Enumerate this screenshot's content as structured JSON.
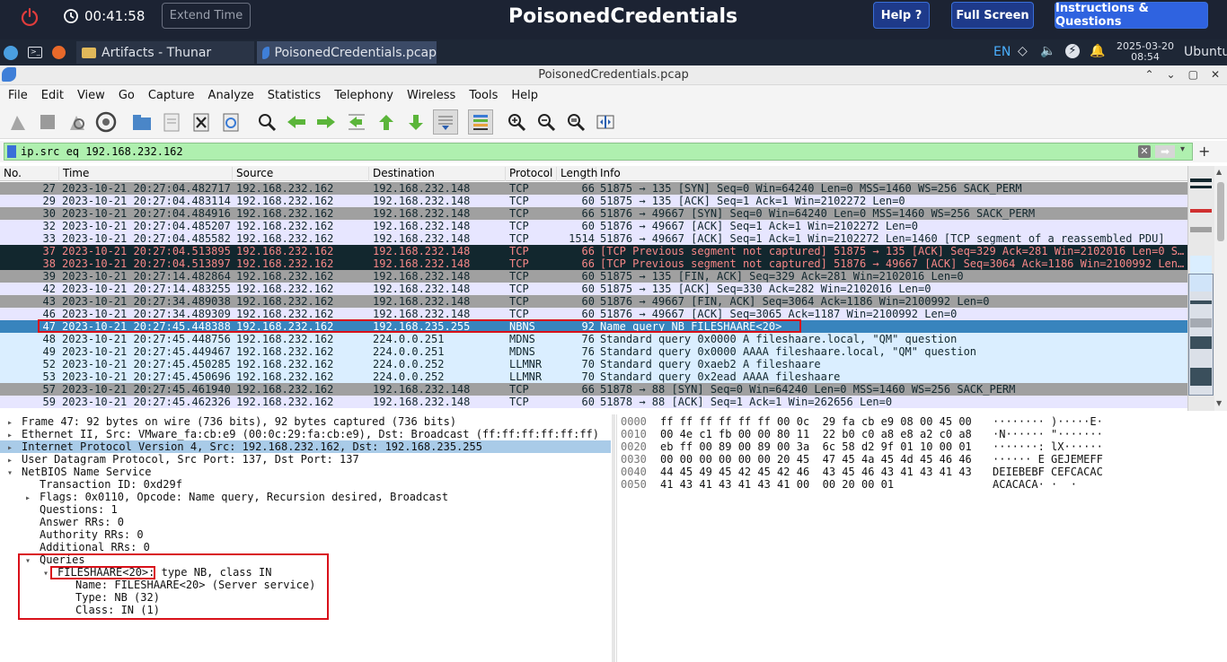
{
  "topbar": {
    "timer": "00:41:58",
    "extend_label": "Extend Time",
    "title": "PoisonedCredentials",
    "help_label": "Help ?",
    "fullscreen_label": "Full Screen",
    "instructions_label": "Instructions & Questions"
  },
  "taskbar": {
    "tasks": [
      "Artifacts - Thunar",
      "PoisonedCredentials.pcap"
    ],
    "lang": "EN",
    "date": "2025-03-20",
    "time": "08:54",
    "user": "Ubuntu"
  },
  "window": {
    "title": "PoisonedCredentials.pcap"
  },
  "menu": [
    "File",
    "Edit",
    "View",
    "Go",
    "Capture",
    "Analyze",
    "Statistics",
    "Telephony",
    "Wireless",
    "Tools",
    "Help"
  ],
  "filter": {
    "value": "ip.src eq 192.168.232.162"
  },
  "packet_list": {
    "columns": [
      "No.",
      "Time",
      "Source",
      "Destination",
      "Protocol",
      "Length",
      "Info"
    ],
    "rows": [
      {
        "no": "27",
        "time": "2023-10-21 20:27:04.482717",
        "src": "192.168.232.162",
        "dst": "192.168.232.148",
        "proto": "TCP",
        "len": "66",
        "info": "51875 → 135 [SYN] Seq=0 Win=64240 Len=0 MSS=1460 WS=256 SACK_PERM",
        "bg": "#a0a0a0",
        "fg": "#12272e"
      },
      {
        "no": "29",
        "time": "2023-10-21 20:27:04.483114",
        "src": "192.168.232.162",
        "dst": "192.168.232.148",
        "proto": "TCP",
        "len": "60",
        "info": "51875 → 135 [ACK] Seq=1 Ack=1 Win=2102272 Len=0",
        "bg": "#e7e6ff",
        "fg": "#12272e"
      },
      {
        "no": "30",
        "time": "2023-10-21 20:27:04.484916",
        "src": "192.168.232.162",
        "dst": "192.168.232.148",
        "proto": "TCP",
        "len": "66",
        "info": "51876 → 49667 [SYN] Seq=0 Win=64240 Len=0 MSS=1460 WS=256 SACK_PERM",
        "bg": "#a0a0a0",
        "fg": "#12272e"
      },
      {
        "no": "32",
        "time": "2023-10-21 20:27:04.485207",
        "src": "192.168.232.162",
        "dst": "192.168.232.148",
        "proto": "TCP",
        "len": "60",
        "info": "51876 → 49667 [ACK] Seq=1 Ack=1 Win=2102272 Len=0",
        "bg": "#e7e6ff",
        "fg": "#12272e"
      },
      {
        "no": "33",
        "time": "2023-10-21 20:27:04.485582",
        "src": "192.168.232.162",
        "dst": "192.168.232.148",
        "proto": "TCP",
        "len": "1514",
        "info": "51876 → 49667 [ACK] Seq=1 Ack=1 Win=2102272 Len=1460 [TCP segment of a reassembled PDU]",
        "bg": "#e7e6ff",
        "fg": "#12272e"
      },
      {
        "no": "37",
        "time": "2023-10-21 20:27:04.513895",
        "src": "192.168.232.162",
        "dst": "192.168.232.148",
        "proto": "TCP",
        "len": "66",
        "info": "[TCP Previous segment not captured] 51875 → 135 [ACK] Seq=329 Ack=281 Win=2102016 Len=0 S…",
        "bg": "#12272e",
        "fg": "#f78787"
      },
      {
        "no": "38",
        "time": "2023-10-21 20:27:04.513897",
        "src": "192.168.232.162",
        "dst": "192.168.232.148",
        "proto": "TCP",
        "len": "66",
        "info": "[TCP Previous segment not captured] 51876 → 49667 [ACK] Seq=3064 Ack=1186 Win=2100992 Len…",
        "bg": "#12272e",
        "fg": "#f78787"
      },
      {
        "no": "39",
        "time": "2023-10-21 20:27:14.482864",
        "src": "192.168.232.162",
        "dst": "192.168.232.148",
        "proto": "TCP",
        "len": "60",
        "info": "51875 → 135 [FIN, ACK] Seq=329 Ack=281 Win=2102016 Len=0",
        "bg": "#a0a0a0",
        "fg": "#12272e"
      },
      {
        "no": "42",
        "time": "2023-10-21 20:27:14.483255",
        "src": "192.168.232.162",
        "dst": "192.168.232.148",
        "proto": "TCP",
        "len": "60",
        "info": "51875 → 135 [ACK] Seq=330 Ack=282 Win=2102016 Len=0",
        "bg": "#e7e6ff",
        "fg": "#12272e"
      },
      {
        "no": "43",
        "time": "2023-10-21 20:27:34.489038",
        "src": "192.168.232.162",
        "dst": "192.168.232.148",
        "proto": "TCP",
        "len": "60",
        "info": "51876 → 49667 [FIN, ACK] Seq=3064 Ack=1186 Win=2100992 Len=0",
        "bg": "#a0a0a0",
        "fg": "#12272e"
      },
      {
        "no": "46",
        "time": "2023-10-21 20:27:34.489309",
        "src": "192.168.232.162",
        "dst": "192.168.232.148",
        "proto": "TCP",
        "len": "60",
        "info": "51876 → 49667 [ACK] Seq=3065 Ack=1187 Win=2100992 Len=0",
        "bg": "#e7e6ff",
        "fg": "#12272e"
      },
      {
        "no": "47",
        "time": "2023-10-21 20:27:45.448388",
        "src": "192.168.232.162",
        "dst": "192.168.235.255",
        "proto": "NBNS",
        "len": "92",
        "info": "Name query NB FILESHAARE<20>",
        "bg": "#3884bd",
        "fg": "#ffffff"
      },
      {
        "no": "48",
        "time": "2023-10-21 20:27:45.448756",
        "src": "192.168.232.162",
        "dst": "224.0.0.251",
        "proto": "MDNS",
        "len": "76",
        "info": "Standard query 0x0000 A fileshaare.local, \"QM\" question",
        "bg": "#daeeff",
        "fg": "#12272e"
      },
      {
        "no": "49",
        "time": "2023-10-21 20:27:45.449467",
        "src": "192.168.232.162",
        "dst": "224.0.0.251",
        "proto": "MDNS",
        "len": "76",
        "info": "Standard query 0x0000 AAAA fileshaare.local, \"QM\" question",
        "bg": "#daeeff",
        "fg": "#12272e"
      },
      {
        "no": "52",
        "time": "2023-10-21 20:27:45.450285",
        "src": "192.168.232.162",
        "dst": "224.0.0.252",
        "proto": "LLMNR",
        "len": "70",
        "info": "Standard query 0xaeb2 A fileshaare",
        "bg": "#daeeff",
        "fg": "#12272e"
      },
      {
        "no": "53",
        "time": "2023-10-21 20:27:45.450696",
        "src": "192.168.232.162",
        "dst": "224.0.0.252",
        "proto": "LLMNR",
        "len": "70",
        "info": "Standard query 0x2ead AAAA fileshaare",
        "bg": "#daeeff",
        "fg": "#12272e"
      },
      {
        "no": "57",
        "time": "2023-10-21 20:27:45.461940",
        "src": "192.168.232.162",
        "dst": "192.168.232.148",
        "proto": "TCP",
        "len": "66",
        "info": "51878 → 88 [SYN] Seq=0 Win=64240 Len=0 MSS=1460 WS=256 SACK_PERM",
        "bg": "#a0a0a0",
        "fg": "#12272e"
      },
      {
        "no": "59",
        "time": "2023-10-21 20:27:45.462326",
        "src": "192.168.232.162",
        "dst": "192.168.232.148",
        "proto": "TCP",
        "len": "60",
        "info": "51878 → 88 [ACK] Seq=1 Ack=1 Win=262656 Len=0",
        "bg": "#e7e6ff",
        "fg": "#12272e"
      }
    ]
  },
  "detail": {
    "lines": [
      {
        "t": "Frame 47: 92 bytes on wire (736 bits), 92 bytes captured (736 bits)",
        "arrow": "▸",
        "indent": 0,
        "sel": false
      },
      {
        "t": "Ethernet II, Src: VMware_fa:cb:e9 (00:0c:29:fa:cb:e9), Dst: Broadcast (ff:ff:ff:ff:ff:ff)",
        "arrow": "▸",
        "indent": 0,
        "sel": false
      },
      {
        "t": "Internet Protocol Version 4, Src: 192.168.232.162, Dst: 192.168.235.255",
        "arrow": "▸",
        "indent": 0,
        "sel": true
      },
      {
        "t": "User Datagram Protocol, Src Port: 137, Dst Port: 137",
        "arrow": "▸",
        "indent": 0,
        "sel": false
      },
      {
        "t": "NetBIOS Name Service",
        "arrow": "▾",
        "indent": 0,
        "sel": false
      },
      {
        "t": "Transaction ID: 0xd29f",
        "arrow": "",
        "indent": 1,
        "sel": false
      },
      {
        "t": "Flags: 0x0110, Opcode: Name query, Recursion desired, Broadcast",
        "arrow": "▸",
        "indent": 1,
        "sel": false
      },
      {
        "t": "Questions: 1",
        "arrow": "",
        "indent": 1,
        "sel": false
      },
      {
        "t": "Answer RRs: 0",
        "arrow": "",
        "indent": 1,
        "sel": false
      },
      {
        "t": "Authority RRs: 0",
        "arrow": "",
        "indent": 1,
        "sel": false
      },
      {
        "t": "Additional RRs: 0",
        "arrow": "",
        "indent": 1,
        "sel": false
      },
      {
        "t": "Queries",
        "arrow": "▾",
        "indent": 1,
        "sel": false
      },
      {
        "t": "FILESHAARE<20>: type NB, class IN",
        "arrow": "▾",
        "indent": 2,
        "sel": false
      },
      {
        "t": "Name: FILESHAARE<20> (Server service)",
        "arrow": "",
        "indent": 3,
        "sel": false
      },
      {
        "t": "Type: NB (32)",
        "arrow": "",
        "indent": 3,
        "sel": false
      },
      {
        "t": "Class: IN (1)",
        "arrow": "",
        "indent": 3,
        "sel": false
      }
    ]
  },
  "bytes": {
    "lines": [
      {
        "off": "0000",
        "hex": "ff ff ff ff ff ff 00 0c  29 fa cb e9 08 00 45 00",
        "asc": "········ )·····E·"
      },
      {
        "off": "0010",
        "hex": "00 4e c1 fb 00 00 80 11  22 b0 c0 a8 e8 a2 c0 a8",
        "asc": "·N······ \"·······"
      },
      {
        "off": "0020",
        "hex": "eb ff 00 89 00 89 00 3a  6c 58 d2 9f 01 10 00 01",
        "asc": "·······: lX······"
      },
      {
        "off": "0030",
        "hex": "00 00 00 00 00 00 20 45  47 45 4a 45 4d 45 46 46",
        "asc": "······ E GEJEMEFF"
      },
      {
        "off": "0040",
        "hex": "44 45 49 45 42 45 42 46  43 45 46 43 41 43 41 43",
        "asc": "DEIEBEBF CEFCACAC"
      },
      {
        "off": "0050",
        "hex": "41 43 41 43 41 43 41 00  00 20 00 01",
        "asc": "ACACACA· ·  ·"
      }
    ]
  },
  "colors": {
    "topbar": "#1c2333",
    "filter": "#aff0af",
    "selected": "#3884bd",
    "highlight_box": "#d9111a"
  }
}
